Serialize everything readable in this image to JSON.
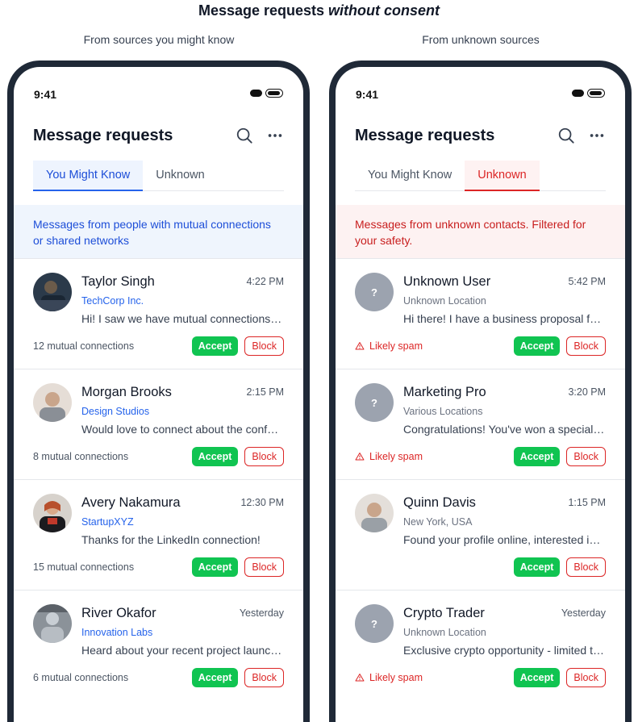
{
  "page": {
    "title_plain": "Message requests ",
    "title_emph": "without consent",
    "left_label": "From sources you might know",
    "right_label": "From unknown sources"
  },
  "left": {
    "status_time": "9:41",
    "header_title": "Message requests",
    "tabs": [
      {
        "label": "You Might Know"
      },
      {
        "label": "Unknown"
      }
    ],
    "active_tab": "You Might Know",
    "banner": "Messages from people with mutual connections or shared networks",
    "items": [
      {
        "name": "Taylor Singh",
        "time": "4:22 PM",
        "sub": "TechCorp Inc.",
        "message": "Hi! I saw we have mutual connections at the...",
        "footer": "12 mutual connections",
        "accept": "Accept",
        "block": "Block",
        "avatar": "photo-avatar"
      },
      {
        "name": "Morgan Brooks",
        "time": "2:15 PM",
        "sub": "Design Studios",
        "message": "Would love to connect about the conference...",
        "footer": "8 mutual connections",
        "accept": "Accept",
        "block": "Block",
        "avatar": "photo-avatar"
      },
      {
        "name": "Avery Nakamura",
        "time": "12:30 PM",
        "sub": "StartupXYZ",
        "message": "Thanks for the LinkedIn connection!",
        "footer": "15 mutual connections",
        "accept": "Accept",
        "block": "Block",
        "avatar": "photo-avatar"
      },
      {
        "name": "River Okafor",
        "time": "Yesterday",
        "sub": "Innovation Labs",
        "message": "Heard about your recent project launch...",
        "footer": "6 mutual connections",
        "accept": "Accept",
        "block": "Block",
        "avatar": "photo-avatar"
      }
    ]
  },
  "right": {
    "status_time": "9:41",
    "header_title": "Message requests",
    "tabs": [
      {
        "label": "You Might Know"
      },
      {
        "label": "Unknown"
      }
    ],
    "active_tab": "Unknown",
    "banner": "Messages from unknown contacts. Filtered for your safety.",
    "items": [
      {
        "name": "Unknown User",
        "time": "5:42 PM",
        "sub": "Unknown Location",
        "message": "Hi there! I have a business proposal for you...",
        "spam": "Likely spam",
        "accept": "Accept",
        "block": "Block",
        "avatar_glyph": "?"
      },
      {
        "name": "Marketing Pro",
        "time": "3:20 PM",
        "sub": "Various Locations",
        "message": "Congratulations! You've won a special prize...",
        "spam": "Likely spam",
        "accept": "Accept",
        "block": "Block",
        "avatar_glyph": "?"
      },
      {
        "name": "Quinn Davis",
        "time": "1:15 PM",
        "sub": "New York, USA",
        "message": "Found your profile online, interested in your...",
        "spam": "",
        "accept": "Accept",
        "block": "Block",
        "avatar": "photo-avatar"
      },
      {
        "name": "Crypto Trader",
        "time": "Yesterday",
        "sub": "Unknown Location",
        "message": "Exclusive crypto opportunity - limited time...",
        "spam": "Likely spam",
        "accept": "Accept",
        "block": "Block",
        "avatar_glyph": "?"
      }
    ]
  },
  "colors": {
    "accept_green": "#10c451",
    "block_red": "#dc2626",
    "info_blue": "#1d4ed8",
    "frame_dark": "#1f2937"
  }
}
